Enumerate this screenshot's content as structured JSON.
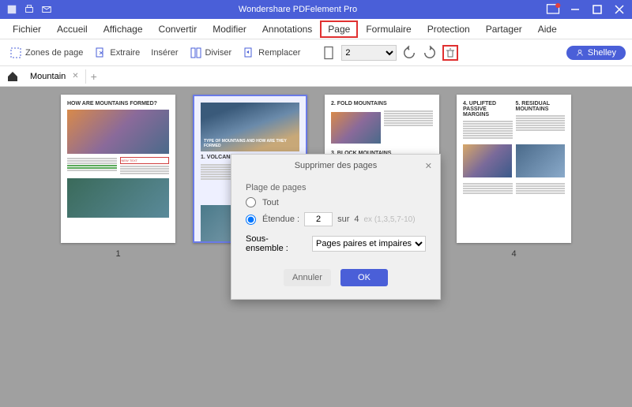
{
  "titlebar": {
    "title": "Wondershare PDFelement Pro"
  },
  "menu": {
    "items": [
      "Fichier",
      "Accueil",
      "Affichage",
      "Convertir",
      "Modifier",
      "Annotations",
      "Page",
      "Formulaire",
      "Protection",
      "Partager",
      "Aide"
    ],
    "highlighted": "Page"
  },
  "toolbar": {
    "zones": "Zones de page",
    "extract": "Extraire",
    "insert": "Insérer",
    "split": "Diviser",
    "replace": "Remplacer",
    "page_value": "2",
    "user": "Shelley"
  },
  "tab": {
    "name": "Mountain"
  },
  "pages": {
    "labels": [
      "1",
      "",
      "",
      "4"
    ],
    "thumb1_title": "HOW ARE MOUNTAINS FORMED?",
    "thumb2_caption": "TYPE OF MOUNTAINS AND HOW ARE THEY FORMED",
    "thumb2_section": "1. VOLCANIC MOUNTAINS",
    "thumb3_s1": "2. FOLD MOUNTAINS",
    "thumb3_s2": "3. BLOCK MOUNTAINS",
    "thumb4_s1": "4. UPLIFTED PASSIVE MARGINS",
    "thumb4_s2": "5. RESIDUAL MOUNTAINS"
  },
  "dialog": {
    "title": "Supprimer des pages",
    "group": "Plage de pages",
    "all": "Tout",
    "range": "Étendue :",
    "range_value": "2",
    "of": "sur",
    "total": "4",
    "hint": "ex (1,3,5,7-10)",
    "subset_label": "Sous-ensemble :",
    "subset_value": "Pages paires et impaires",
    "cancel": "Annuler",
    "ok": "OK"
  }
}
